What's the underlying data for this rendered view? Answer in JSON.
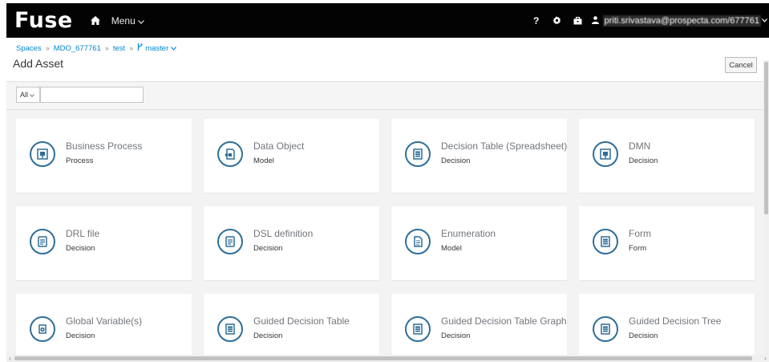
{
  "navbar": {
    "brand": "Fuse",
    "menu_label": "Menu",
    "help_icon_glyph": "?",
    "user_label": "priti.srivastava@prospecta.com/677761"
  },
  "header": {
    "breadcrumb": {
      "spaces": "Spaces",
      "space": "MDO_677761",
      "project": "test",
      "branch": "master"
    },
    "title": "Add Asset",
    "cancel_label": "Cancel"
  },
  "filter": {
    "select_value": "All",
    "search_value": ""
  },
  "cards": [
    {
      "title": "Business Process",
      "type": "Process",
      "icon": "business-process-icon"
    },
    {
      "title": "Data Object",
      "type": "Model",
      "icon": "data-object-icon"
    },
    {
      "title": "Decision Table (Spreadsheet)",
      "type": "Decision",
      "icon": "decision-table-icon"
    },
    {
      "title": "DMN",
      "type": "Decision",
      "icon": "dmn-icon"
    },
    {
      "title": "DRL file",
      "type": "Decision",
      "icon": "drl-file-icon"
    },
    {
      "title": "DSL definition",
      "type": "Decision",
      "icon": "dsl-definition-icon"
    },
    {
      "title": "Enumeration",
      "type": "Model",
      "icon": "enumeration-icon"
    },
    {
      "title": "Form",
      "type": "Form",
      "icon": "form-icon"
    },
    {
      "title": "Global Variable(s)",
      "type": "Decision",
      "icon": "global-variables-icon"
    },
    {
      "title": "Guided Decision Table",
      "type": "Decision",
      "icon": "guided-decision-table-icon"
    },
    {
      "title": "Guided Decision Table Graph",
      "type": "Decision",
      "icon": "guided-decision-table-graph-icon"
    },
    {
      "title": "Guided Decision Tree",
      "type": "Decision",
      "icon": "guided-decision-tree-icon"
    }
  ],
  "colors": {
    "navbar_bg": "#030303",
    "link": "#0088ce",
    "icon_ring": "#2e6e98",
    "page_bg": "#f3f3f3"
  }
}
